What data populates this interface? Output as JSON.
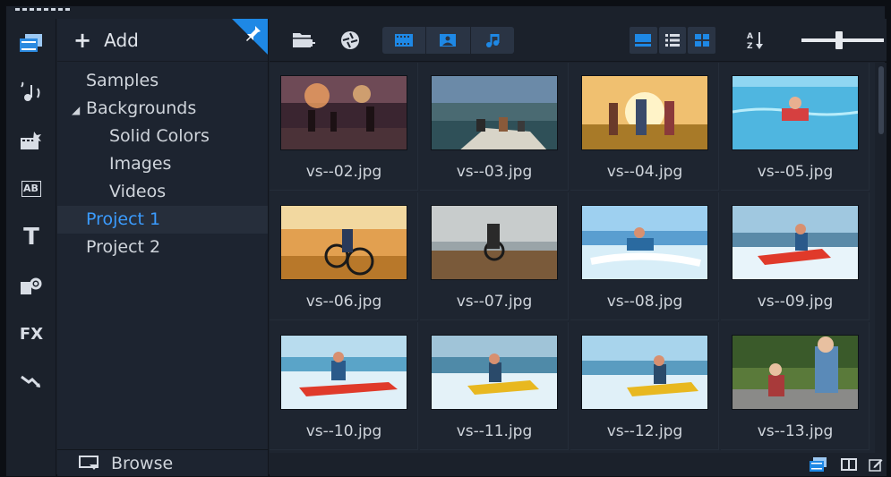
{
  "rail": {
    "items": [
      {
        "id": "media",
        "icon": "media-library-icon",
        "active": true
      },
      {
        "id": "audio",
        "icon": "music-notes-icon"
      },
      {
        "id": "instant",
        "icon": "instant-project-icon"
      },
      {
        "id": "transition",
        "icon": "transition-ab-icon",
        "text": "AB"
      },
      {
        "id": "title",
        "icon": "title-t-icon",
        "text": "T"
      },
      {
        "id": "graphics",
        "icon": "graphics-icon"
      },
      {
        "id": "filters",
        "icon": "fx-icon",
        "text": "FX"
      },
      {
        "id": "path",
        "icon": "motion-path-icon"
      }
    ]
  },
  "library": {
    "add_label": "Add",
    "tree": [
      {
        "label": "Samples",
        "level": 0
      },
      {
        "label": "Backgrounds",
        "level": 0,
        "expanded": true
      },
      {
        "label": "Solid Colors",
        "level": 1
      },
      {
        "label": "Images",
        "level": 1
      },
      {
        "label": "Videos",
        "level": 1
      },
      {
        "label": "Project 1",
        "level": 0,
        "selected": true
      },
      {
        "label": "Project 2",
        "level": 0
      }
    ],
    "browse_label": "Browse"
  },
  "toolbar": {
    "sort_glyph": "A↓Z",
    "zoom_level": 0.45,
    "accent": "#1e88e5"
  },
  "media": [
    {
      "name": "vs--02.jpg",
      "scene": "sunset-sparklers"
    },
    {
      "name": "vs--03.jpg",
      "scene": "boat-lake"
    },
    {
      "name": "vs--04.jpg",
      "scene": "running-field"
    },
    {
      "name": "vs--05.jpg",
      "scene": "swimming-pool"
    },
    {
      "name": "vs--06.jpg",
      "scene": "bike-desert"
    },
    {
      "name": "vs--07.jpg",
      "scene": "bike-rocks"
    },
    {
      "name": "vs--08.jpg",
      "scene": "kayak-blue"
    },
    {
      "name": "vs--09.jpg",
      "scene": "kayak-red"
    },
    {
      "name": "vs--10.jpg",
      "scene": "kayak-red2"
    },
    {
      "name": "vs--11.jpg",
      "scene": "kayak-yellow"
    },
    {
      "name": "vs--12.jpg",
      "scene": "kayak-yellow2"
    },
    {
      "name": "vs--13.jpg",
      "scene": "kids-park"
    }
  ]
}
